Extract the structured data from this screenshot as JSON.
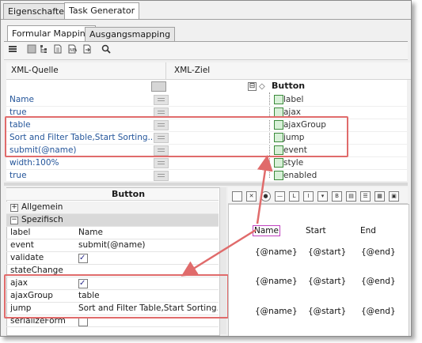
{
  "tabs_top": [
    {
      "label": "Eigenschaften",
      "active": false
    },
    {
      "label": "Task Generator",
      "active": true
    }
  ],
  "tabs_sub": [
    {
      "label": "Formular Mapping",
      "active": true
    },
    {
      "label": "Ausgangsmapping",
      "active": false
    }
  ],
  "grid": {
    "header_source": "XML-Quelle",
    "header_target": "XML-Ziel",
    "root_target": "Button",
    "rows": [
      {
        "source": "Name",
        "target": "label"
      },
      {
        "source": "true",
        "target": "ajax"
      },
      {
        "source": "table",
        "target": "ajaxGroup"
      },
      {
        "source": "Sort and Filter Table,Start Sorting...",
        "target": "jump"
      },
      {
        "source": "submit(@name)",
        "target": "event"
      },
      {
        "source": "width:100%",
        "target": "style"
      },
      {
        "source": "true",
        "target": "enabled"
      }
    ]
  },
  "properties": {
    "title": "Button",
    "group_general": "Allgemein",
    "group_specific": "Spezifisch",
    "rows": [
      {
        "key": "label",
        "value": "Name"
      },
      {
        "key": "event",
        "value": "submit(@name)"
      },
      {
        "key": "validate",
        "value": "",
        "checkbox": true,
        "checked": true
      },
      {
        "key": "stateChange",
        "value": ""
      },
      {
        "key": "ajax",
        "value": "",
        "checkbox": true,
        "checked": true
      },
      {
        "key": "ajaxGroup",
        "value": "table"
      },
      {
        "key": "jump",
        "value": "Sort and Filter Table,Start Sorting..."
      },
      {
        "key": "serializeForm",
        "value": "",
        "checkbox": true,
        "checked": false
      }
    ]
  },
  "designer": {
    "headers": [
      "Name",
      "Start",
      "End"
    ],
    "rows": [
      [
        "{@name}",
        "{@start}",
        "{@end}"
      ],
      [
        "{@name}",
        "{@start}",
        "{@end}"
      ],
      [
        "{@name}",
        "{@start}",
        "{@end}"
      ]
    ]
  },
  "colors": {
    "highlight_box": "#e06b6b",
    "source_text": "#24559a",
    "selected_header_border": "#c040c0"
  }
}
